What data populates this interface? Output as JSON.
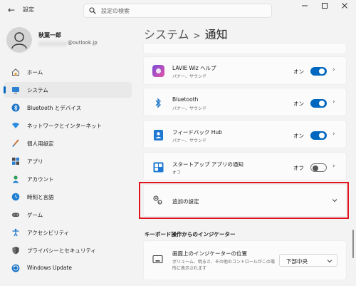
{
  "window": {
    "title": "設定",
    "search_placeholder": "設定の検索"
  },
  "user": {
    "name": "秋葉一郎",
    "email": "@outlook.jp"
  },
  "sidebar": {
    "items": [
      {
        "label": "ホーム",
        "icon": "home-icon"
      },
      {
        "label": "システム",
        "icon": "system-icon",
        "active": true
      },
      {
        "label": "Bluetooth とデバイス",
        "icon": "bluetooth-icon"
      },
      {
        "label": "ネットワークとインターネット",
        "icon": "wifi-icon"
      },
      {
        "label": "個人用設定",
        "icon": "brush-icon"
      },
      {
        "label": "アプリ",
        "icon": "apps-icon"
      },
      {
        "label": "アカウント",
        "icon": "account-icon"
      },
      {
        "label": "時刻と言語",
        "icon": "globe-clock-icon"
      },
      {
        "label": "ゲーム",
        "icon": "gamepad-icon"
      },
      {
        "label": "アクセシビリティ",
        "icon": "accessibility-icon"
      },
      {
        "label": "プライバシーとセキュリティ",
        "icon": "shield-icon"
      },
      {
        "label": "Windows Update",
        "icon": "update-icon"
      }
    ]
  },
  "breadcrumb": {
    "parent": "システム",
    "separator": ">",
    "current": "通知"
  },
  "notifications": [
    {
      "title": "LAVIE Wiz ヘルプ",
      "subtitle": "バナー、サウンド",
      "state": "オン",
      "on": true
    },
    {
      "title": "Bluetooth",
      "subtitle": "バナー、サウンド",
      "state": "オン",
      "on": true
    },
    {
      "title": "フィードバック Hub",
      "subtitle": "バナー、サウンド",
      "state": "オン",
      "on": true
    },
    {
      "title": "スタートアップ アプリの通知",
      "subtitle": "オフ",
      "state": "オフ",
      "on": false
    }
  ],
  "additional_settings": {
    "label": "追加の設定"
  },
  "keyboard_section": {
    "header": "キーボード操作からのインジケーター",
    "indicator_position": {
      "title": "画面上のインジケーターの位置",
      "desc_line1": "ボリューム、明るさ、その他のコントロールがこの場",
      "desc_line2": "所に表示されます",
      "value": "下部中央"
    }
  },
  "colors": {
    "accent": "#0067c0",
    "highlight": "#e0141e"
  }
}
